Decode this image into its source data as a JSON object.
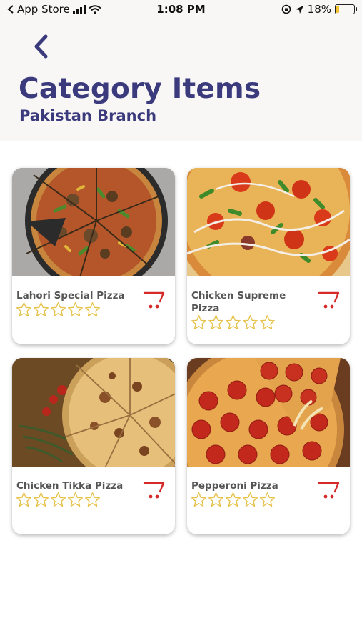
{
  "status_bar": {
    "carrier": "App Store",
    "time": "1:08 PM",
    "battery_percent": "18%",
    "battery_level": 0.18
  },
  "header": {
    "back_icon": "chevron-left-icon",
    "title": "Category Items",
    "subtitle": "Pakistan Branch"
  },
  "colors": {
    "title": "#3a3a7c",
    "cart": "#d42a2a",
    "star_outline": "#e6c24a",
    "background_top": "#f8f7f6"
  },
  "items": [
    {
      "name": "Lahori Special Pizza",
      "rating": 0,
      "max_rating": 5,
      "cart_icon": "cart-icon"
    },
    {
      "name": "Chicken Supreme Pizza",
      "rating": 0,
      "max_rating": 5,
      "cart_icon": "cart-icon"
    },
    {
      "name": "Chicken Tikka Pizza",
      "rating": 0,
      "max_rating": 5,
      "cart_icon": "cart-icon"
    },
    {
      "name": "Pepperoni Pizza",
      "rating": 0,
      "max_rating": 5,
      "cart_icon": "cart-icon"
    }
  ]
}
